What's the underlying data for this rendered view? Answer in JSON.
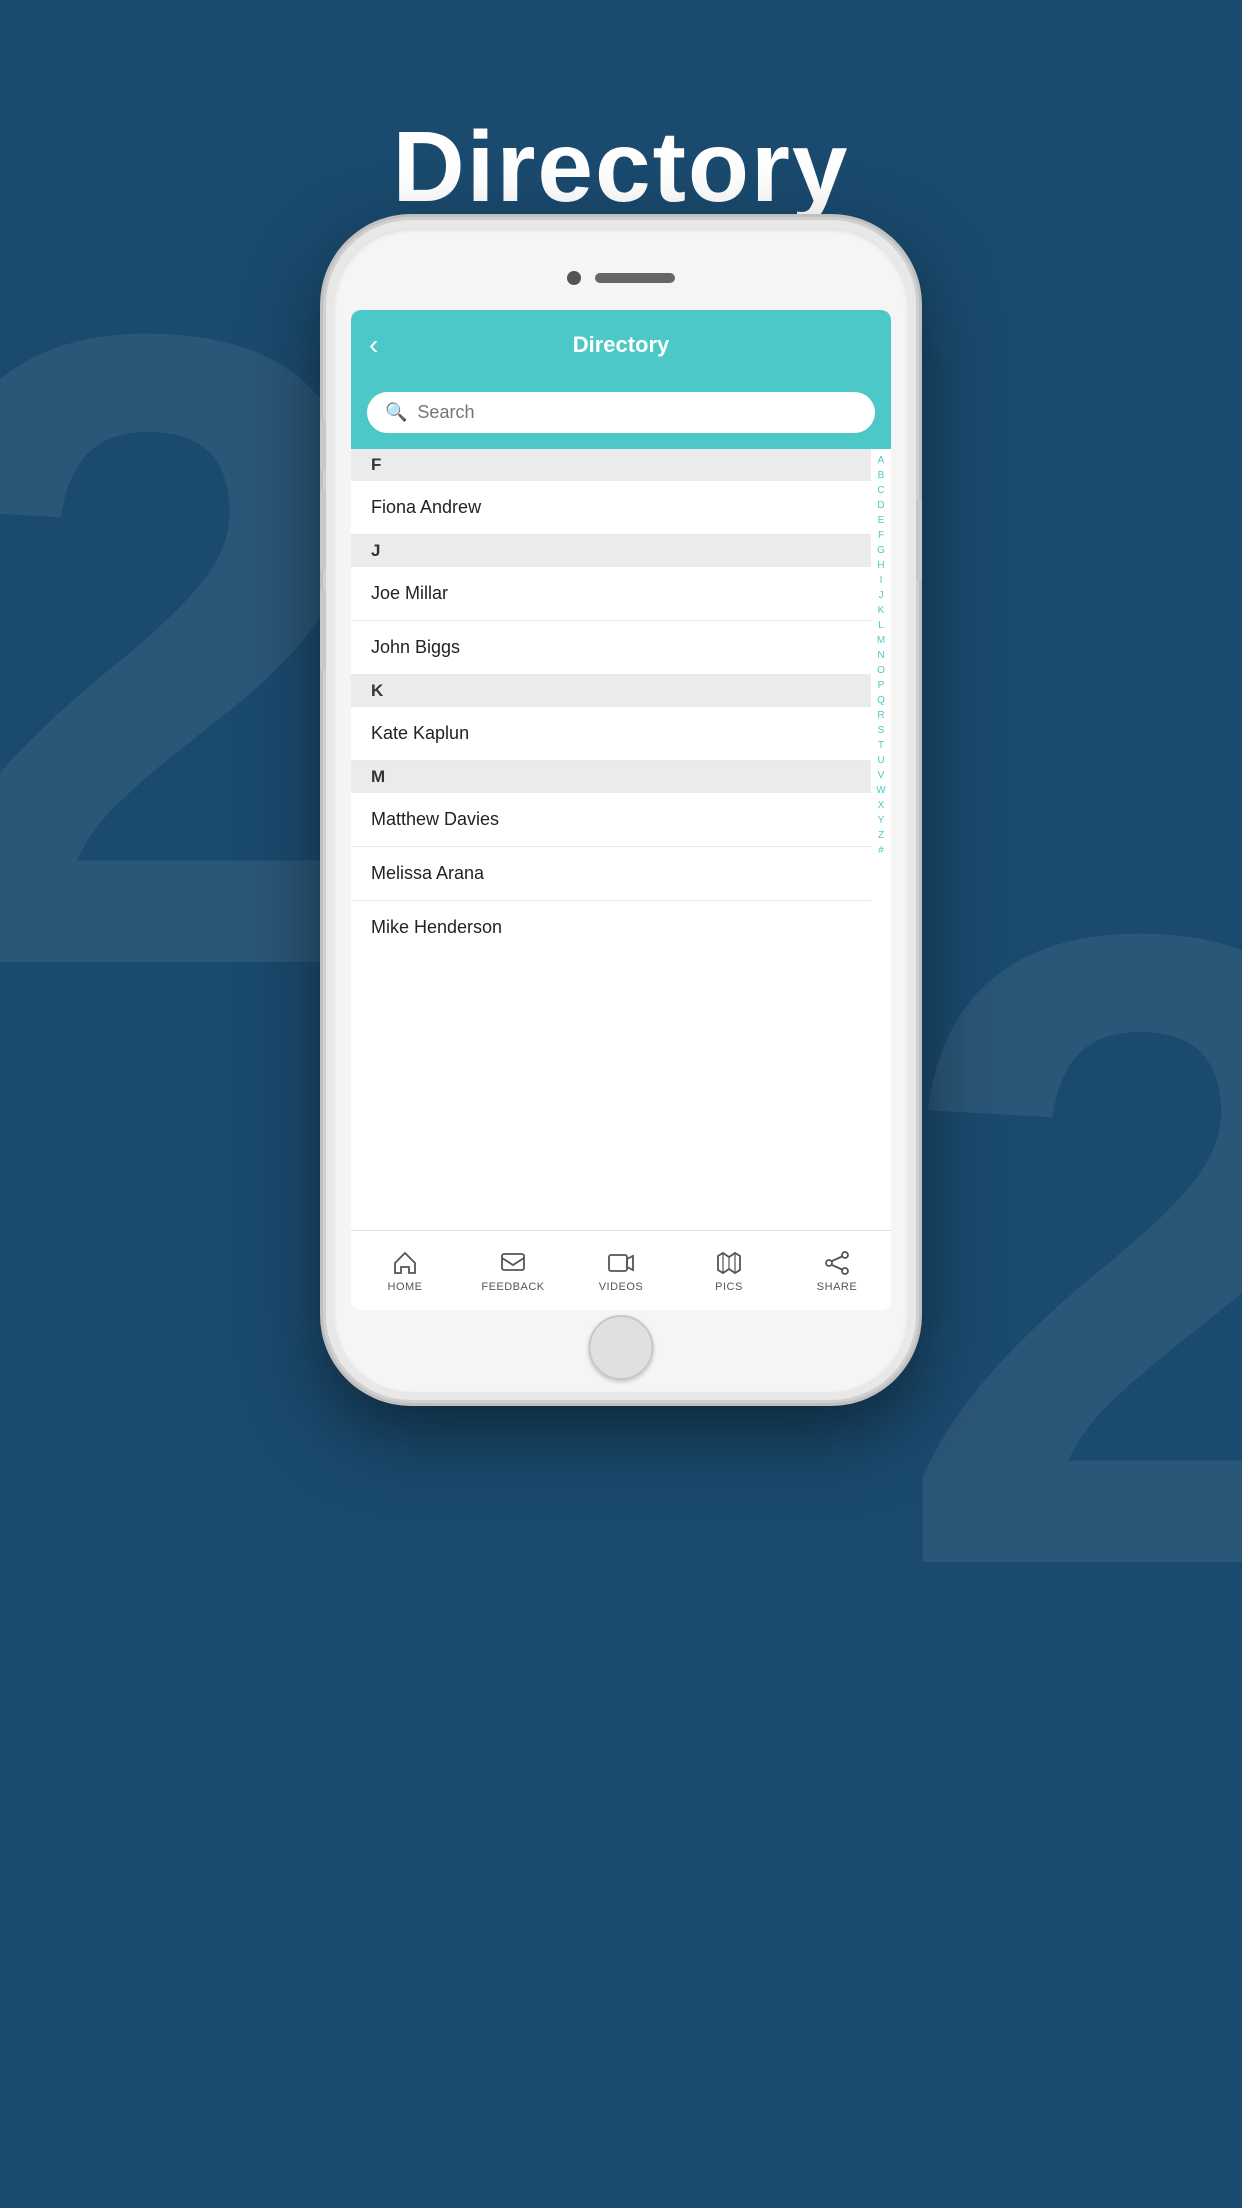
{
  "page": {
    "title": "Directory",
    "background_color": "#1a4a6e"
  },
  "app": {
    "header": {
      "title": "Directory",
      "back_label": "‹"
    },
    "search": {
      "placeholder": "Search"
    },
    "sections": [
      {
        "letter": "F",
        "contacts": [
          {
            "name": "Fiona Andrew"
          }
        ]
      },
      {
        "letter": "J",
        "contacts": [
          {
            "name": "Joe Millar"
          },
          {
            "name": "John Biggs"
          }
        ]
      },
      {
        "letter": "K",
        "contacts": [
          {
            "name": "Kate Kaplun"
          }
        ]
      },
      {
        "letter": "M",
        "contacts": [
          {
            "name": "Matthew Davies"
          },
          {
            "name": "Melissa Arana"
          },
          {
            "name": "Mike Henderson"
          }
        ]
      }
    ],
    "alphabet": [
      "A",
      "B",
      "C",
      "D",
      "E",
      "F",
      "G",
      "H",
      "I",
      "J",
      "K",
      "L",
      "M",
      "N",
      "O",
      "P",
      "Q",
      "R",
      "S",
      "T",
      "U",
      "V",
      "W",
      "X",
      "Y",
      "Z",
      "#"
    ],
    "tabs": [
      {
        "id": "home",
        "label": "HOME"
      },
      {
        "id": "feedback",
        "label": "FEEDBACK"
      },
      {
        "id": "videos",
        "label": "VIDEOS"
      },
      {
        "id": "pics",
        "label": "PICS"
      },
      {
        "id": "share",
        "label": "SHARE"
      }
    ]
  }
}
